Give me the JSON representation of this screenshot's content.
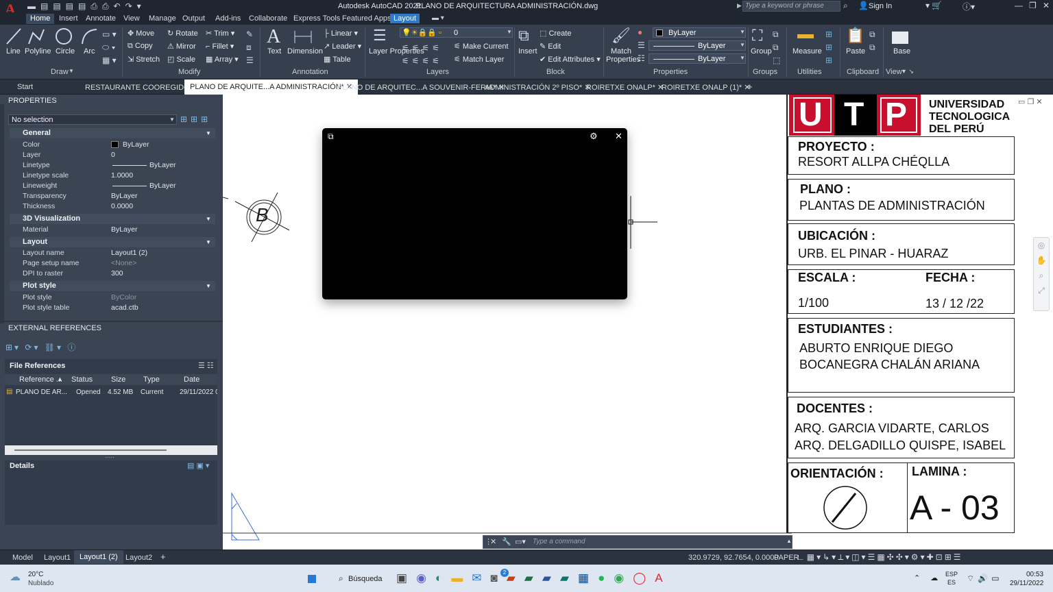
{
  "app": {
    "title": "Autodesk AutoCAD 2021",
    "file": "PLANO DE ARQUITECTURA ADMINISTRACIÓN.dwg",
    "search_placeholder": "Type a keyword or phrase",
    "sign_in": "Sign In",
    "logo": "A"
  },
  "ribbon_tabs": [
    "Home",
    "Insert",
    "Annotate",
    "View",
    "Manage",
    "Output",
    "Add-ins",
    "Collaborate",
    "Express Tools",
    "Featured Apps",
    "Layout"
  ],
  "ribbon": {
    "draw": {
      "label": "Draw",
      "line": "Line",
      "polyline": "Polyline",
      "circle": "Circle",
      "arc": "Arc"
    },
    "modify": {
      "label": "Modify",
      "move": "Move",
      "rotate": "Rotate",
      "trim": "Trim",
      "copy": "Copy",
      "mirror": "Mirror",
      "fillet": "Fillet",
      "stretch": "Stretch",
      "scale": "Scale",
      "array": "Array"
    },
    "annotation": {
      "label": "Annotation",
      "text": "Text",
      "dimension": "Dimension",
      "linear": "Linear",
      "leader": "Leader",
      "table": "Table"
    },
    "layers": {
      "label": "Layers",
      "layer_properties": "Layer Properties",
      "current_layer": "0",
      "make_current": "Make Current",
      "match_layer": "Match Layer"
    },
    "block": {
      "label": "Block",
      "insert": "Insert",
      "create": "Create",
      "edit": "Edit",
      "edit_attributes": "Edit Attributes"
    },
    "properties": {
      "label": "Properties",
      "match_properties": "Match Properties",
      "color": "ByLayer",
      "lineweight": "ByLayer",
      "linetype": "ByLayer"
    },
    "groups": {
      "label": "Groups",
      "group": "Group"
    },
    "utilities": {
      "label": "Utilities",
      "measure": "Measure"
    },
    "clipboard": {
      "label": "Clipboard",
      "paste": "Paste"
    },
    "view": {
      "label": "View",
      "base": "Base"
    }
  },
  "doc_tabs": [
    "Start",
    "RESTAURANTE COOREGIDO*",
    "PLANO DE ARQUITE...A ADMINISTRACIÓN*",
    "PLANO DE ARQUITEC...A SOUVENIR-FERIA*",
    "ADMINISTRACIÓN 2º PISO*",
    "ROIRETXE ONALP*",
    "ROIRETXE ONALP (1)*"
  ],
  "properties_panel": {
    "title": "PROPERTIES",
    "selection": "No selection",
    "general": {
      "header": "General",
      "rows": [
        [
          "Color",
          "ByLayer"
        ],
        [
          "Layer",
          "0"
        ],
        [
          "Linetype",
          "ByLayer"
        ],
        [
          "Linetype scale",
          "1.0000"
        ],
        [
          "Lineweight",
          "ByLayer"
        ],
        [
          "Transparency",
          "ByLayer"
        ],
        [
          "Thickness",
          "0.0000"
        ]
      ]
    },
    "viz": {
      "header": "3D Visualization",
      "rows": [
        [
          "Material",
          "ByLayer"
        ]
      ]
    },
    "layout": {
      "header": "Layout",
      "rows": [
        [
          "Layout name",
          "Layout1 (2)"
        ],
        [
          "Page setup name",
          "<None>"
        ],
        [
          "DPI to raster",
          "300"
        ]
      ]
    },
    "plot": {
      "header": "Plot style",
      "rows": [
        [
          "Plot style",
          "ByColor"
        ],
        [
          "Plot style table",
          "acad.ctb"
        ]
      ]
    }
  },
  "xref": {
    "title": "EXTERNAL REFERENCES",
    "file_refs": "File References",
    "columns": [
      "Reference ...",
      "Status",
      "Size",
      "Type",
      "Date"
    ],
    "row": [
      "PLANO DE AR...",
      "Opened",
      "4.52 MB",
      "Current",
      "29/11/2022 0("
    ],
    "details": "Details"
  },
  "drawing": {
    "grid_bubble": "B"
  },
  "title_block": {
    "logo_letters": [
      "U",
      "T",
      "P"
    ],
    "uni_lines": [
      "UNIVERSIDAD",
      "TECNOLOGICA",
      "DEL PERÚ"
    ],
    "proyecto_label": "PROYECTO  :",
    "proyecto": "RESORT ALLPA CHÉQLLA",
    "plano_label": "PLANO  :",
    "plano": "PLANTAS DE ADMINISTRACIÓN",
    "ubicacion_label": "UBICACIÓN :",
    "ubicacion": "URB. EL PINAR - HUARAZ",
    "escala_label": "ESCALA :",
    "escala": "1/100",
    "fecha_label": "FECHA :",
    "fecha": "13 / 12 /22",
    "estudiantes_label": "ESTUDIANTES :",
    "estudiantes": [
      "ABURTO ENRIQUE DIEGO",
      "BOCANEGRA CHALÁN ARIANA"
    ],
    "docentes_label": "DOCENTES :",
    "docentes": [
      "ARQ. GARCIA VIDARTE, CARLOS",
      "ARQ. DELGADILLO QUISPE, ISABEL"
    ],
    "orientacion_label": "ORIENTACIÓN :",
    "lamina_label": "LAMINA :",
    "lamina": "A - 03"
  },
  "command": {
    "placeholder": "Type  a  command"
  },
  "layout_tabs": [
    "Model",
    "Layout1",
    "Layout1 (2)",
    "Layout2"
  ],
  "status": {
    "coords": "320.9729, 92.7654, 0.0000",
    "space": "PAPER"
  },
  "taskbar": {
    "weather_temp": "20°C",
    "weather_desc": "Nublado",
    "search": "Búsqueda",
    "lang1": "ESP",
    "lang2": "ES",
    "time": "00:53",
    "date": "29/11/2022",
    "mail_badge": "2"
  }
}
